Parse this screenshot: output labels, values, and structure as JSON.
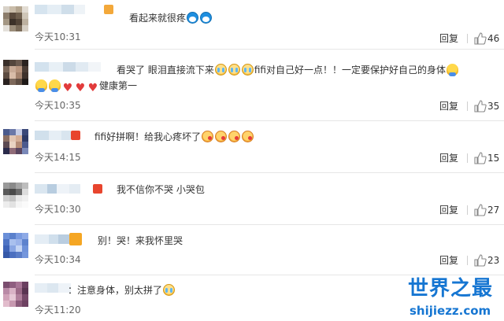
{
  "colors": {
    "separator": "#e6e6e6",
    "time_text": "#666666",
    "body_text": "#333333",
    "watermark": "#1676d2"
  },
  "comments": [
    {
      "text_before": "看起来就很疼",
      "emoticons": [
        "doraemon-icon",
        "doraemon-icon"
      ],
      "time": "今天10:31",
      "reply_label": "回复",
      "likes": "46"
    },
    {
      "text_before": "看哭了 眼泪直接流下来",
      "emoticons_a": [
        "crying-face-icon",
        "crying-face-icon",
        "crying-face-icon"
      ],
      "text_middle": "fifi对自己好一点！！一定要保护好自己的身体",
      "emoticons_b": [
        "hug-icon",
        "hug-icon",
        "hug-icon",
        "heart-icon",
        "heart-icon",
        "heart-icon"
      ],
      "text_after": "健康第一",
      "time": "今天10:35",
      "reply_label": "回复",
      "likes": "35"
    },
    {
      "text_before": "fifi好拼啊！给我心疼坏了",
      "emoticons": [
        "kiss-face-icon",
        "kiss-face-icon",
        "kiss-face-icon",
        "kiss-face-icon"
      ],
      "time": "今天14:15",
      "reply_label": "回复",
      "likes": "15"
    },
    {
      "text_before": "我不信你不哭 小哭包",
      "time": "今天10:30",
      "reply_label": "回复",
      "likes": "27"
    },
    {
      "text_before": "别！哭！来我怀里哭",
      "time": "今天10:34",
      "reply_label": "回复",
      "likes": "23"
    },
    {
      "text_before": "：注意身体，别太拼了",
      "emoticons": [
        "crying-face-icon"
      ],
      "time": "今天11:20"
    }
  ],
  "watermark": {
    "main": "世界之最",
    "sub": "shijiezz.com"
  }
}
